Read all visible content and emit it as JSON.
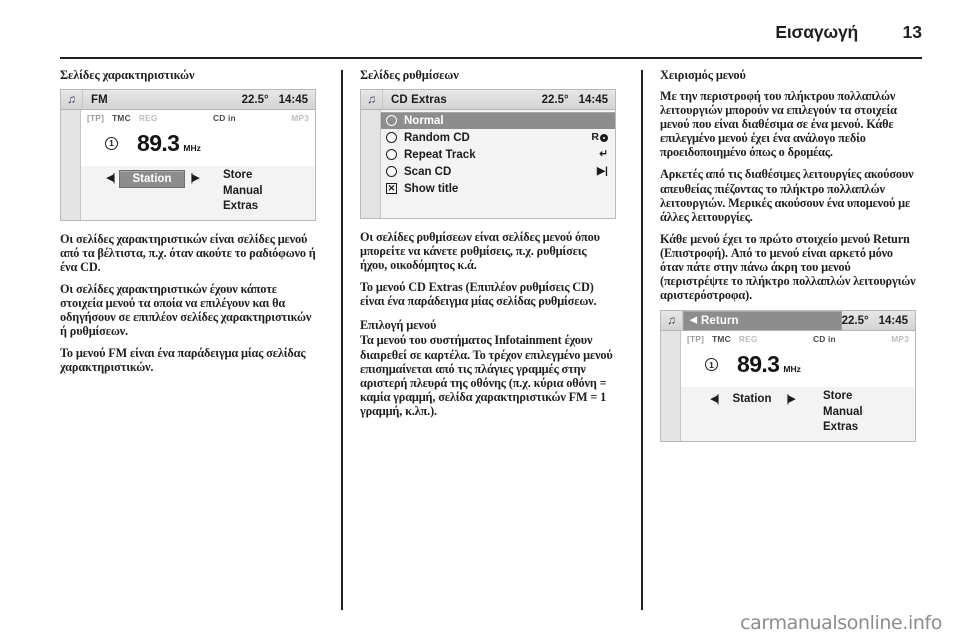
{
  "header": {
    "title": "Εισαγωγή",
    "page_number": "13"
  },
  "columns": {
    "left": {
      "section_title": "Σελίδες χαρακτηριστικών",
      "paragraphs": [
        "Οι σελίδες χαρακτηριστικών είναι σελίδες μενού από τα βέλτιστα, π.χ. όταν ακούτε το ραδιόφωνο ή ένα CD.",
        "Οι σελίδες χαρακτηριστικών έχουν κάποτε στοιχεία μενού τα οποία να επιλέγουν και θα οδηγήσουν σε επιπλέον σελίδες χαρακτηριστικών ή ρυθμίσεων.",
        "Το μενού FM είναι ένα παράδειγμα μίας σελίδας χαρακτηριστικών."
      ],
      "display": {
        "mode_label": "FM",
        "note_icon": "music-note-icon",
        "temperature": "22.5°",
        "time": "14:45",
        "status": {
          "tp": "[TP]",
          "tmc": "TMC",
          "reg": "REG",
          "cd": "CD in",
          "mp3": "MP3"
        },
        "preset": "1",
        "frequency": "89.3",
        "unit": "MHz",
        "prev_icon": "skip-previous-icon",
        "next_icon": "skip-next-icon",
        "station_label": "Station",
        "options": [
          "Store",
          "Manual",
          "Extras"
        ]
      }
    },
    "middle": {
      "section_title": "Σελίδες ρυθμίσεων",
      "paragraphs": [
        "Οι σελίδες ρυθμίσεων είναι σελίδες μενού όπου μπορείτε να κάνετε ρυθμίσεις, π.χ. ρυθμίσεις ήχου, οικοδόμητος κ.ά.",
        "Το μενού CD Extras (Επιπλέον ρυθμίσεις CD) είναι ένα παράδειγμα μίας σελίδας ρυθμίσεων."
      ],
      "sub_title": "Επιλογή μενού",
      "sub_paragraphs": [
        "Τα μενού του συστήματος Infotainment έχουν διαιρεθεί σε καρτέλα. Το τρέχον επιλεγμένο μενού επισημαίνεται από τις πλάγιες γραμμές στην αριστερή πλευρά της οθόνης (π.χ. κύρια οθόνη = καμία γραμμή, σελίδα χαρακτηριστικών FM = 1 γραμμή, κ.λπ.)."
      ],
      "display": {
        "mode_label": "CD Extras",
        "note_icon": "music-note-icon",
        "temperature": "22.5°",
        "time": "14:45",
        "items": [
          {
            "label": "Normal",
            "control": "radio",
            "selected": true,
            "icon": ""
          },
          {
            "label": "Random CD",
            "control": "radio",
            "selected": false,
            "icon": "random-cd-icon"
          },
          {
            "label": "Repeat Track",
            "control": "radio",
            "selected": false,
            "icon": "repeat-icon"
          },
          {
            "label": "Scan CD",
            "control": "radio",
            "selected": false,
            "icon": "scan-icon"
          },
          {
            "label": "Show title",
            "control": "checkbox",
            "selected": false,
            "icon": ""
          }
        ]
      }
    },
    "right": {
      "section_title": "Χειρισμός μενού",
      "paragraphs": [
        "Με την περιστροφή του πλήκτρου πολλαπλών λειτουργιών μπορούν να επιλεγούν τα στοιχεία μενού που είναι διαθέσιμα σε ένα μενού. Κάθε επιλεγμένο μενού έχει ένα ανάλογο πεδίο προειδοποιημένο όπως ο δρομέας.",
        "Αρκετές από τις διαθέσιμες λειτουργίες ακούσουν απευθείας πιέζοντας το πλήκτρο πολλαπλών λειτουργιών. Μερικές ακούσουν ένα υπομενού με άλλες λειτουργίες.",
        "Κάθε μενού έχει το πρώτο στοιχείο μενού Return (Επιστροφή). Από το μενού είναι αρκετό μόνο όταν πάτε στην πάνω άκρη του μενού (περιστρέψτε το πλήκτρο πολλαπλών λειτουργιών αριστερόστροφα)."
      ],
      "display": {
        "mode_label": "Return",
        "return_arrow": "◀",
        "note_icon": "music-note-icon",
        "temperature": "22.5°",
        "time": "14:45",
        "status": {
          "tp": "[TP]",
          "tmc": "TMC",
          "reg": "REG",
          "cd": "CD in",
          "mp3": "MP3"
        },
        "preset": "1",
        "frequency": "89.3",
        "unit": "MHz",
        "prev_icon": "skip-previous-icon",
        "next_icon": "skip-next-icon",
        "station_label": "Station",
        "options": [
          "Store",
          "Manual",
          "Extras"
        ]
      }
    }
  },
  "watermark": "carmanualsonline.info"
}
